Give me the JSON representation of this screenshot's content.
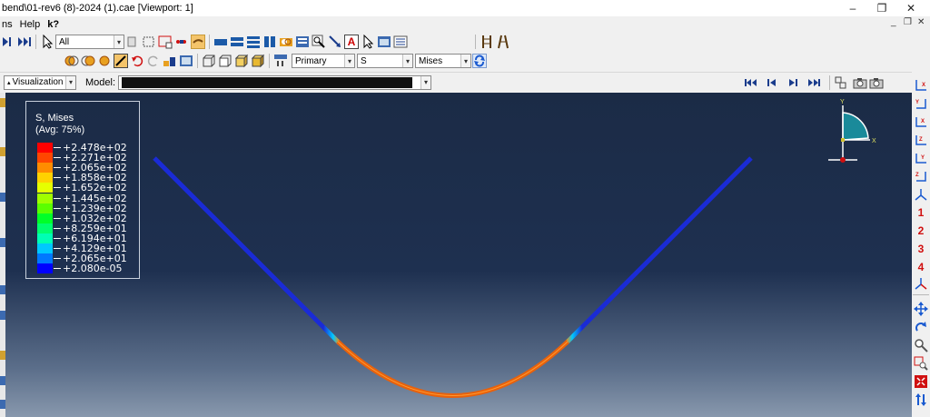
{
  "window": {
    "title": "bend\\01-rev6 (8)-2024 (1).cae [Viewport: 1]"
  },
  "menu": [
    "ns",
    "Help",
    "k?"
  ],
  "toolbar1": {
    "selection_filter": "All"
  },
  "toolbar2": {
    "field_position": "Primary",
    "field_variable": "S",
    "field_component": "Mises"
  },
  "context": {
    "module_label": "Visualization",
    "model_label": "Model:"
  },
  "legend": {
    "title_line1": "S, Mises",
    "title_line2": "(Avg: 75%)",
    "entries": [
      {
        "value": "+2.478e+02",
        "color": "#ff0000"
      },
      {
        "value": "+2.271e+02",
        "color": "#ff4600"
      },
      {
        "value": "+2.065e+02",
        "color": "#ff8c00"
      },
      {
        "value": "+1.858e+02",
        "color": "#ffd200"
      },
      {
        "value": "+1.652e+02",
        "color": "#e6ff00"
      },
      {
        "value": "+1.445e+02",
        "color": "#a0ff00"
      },
      {
        "value": "+1.239e+02",
        "color": "#5aff00"
      },
      {
        "value": "+1.032e+02",
        "color": "#00ff28"
      },
      {
        "value": "+8.259e+01",
        "color": "#00ff6e"
      },
      {
        "value": "+6.194e+01",
        "color": "#00ffb4"
      },
      {
        "value": "+4.129e+01",
        "color": "#00c8ff"
      },
      {
        "value": "+2.065e+01",
        "color": "#0078ff"
      },
      {
        "value": "+2.080e-05",
        "color": "#0000ff"
      }
    ]
  },
  "triad": {
    "y_label": "Y",
    "x_label": "X"
  },
  "right_strip": {
    "numbers": [
      "1",
      "2",
      "3",
      "4"
    ]
  },
  "colors": {
    "viewport_top": "#1b2b46",
    "beam_straight": "#1a2bd6",
    "beam_curve": "#e8610c"
  }
}
